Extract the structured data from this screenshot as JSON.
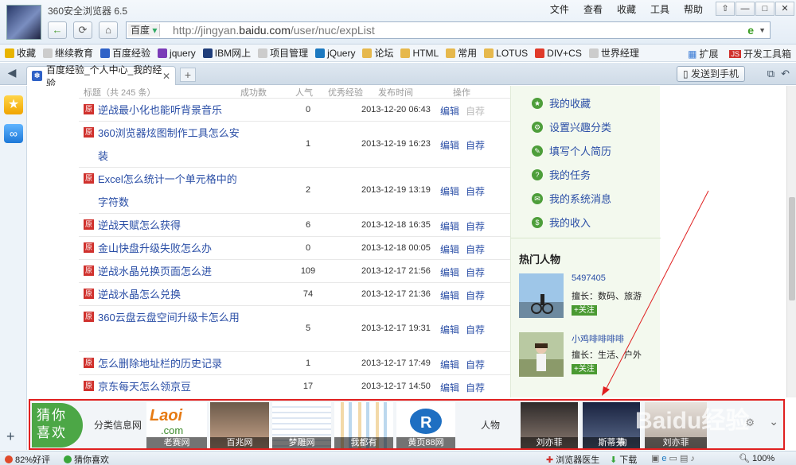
{
  "window": {
    "title": "360安全浏览器 6.5",
    "menus": [
      "文件",
      "查看",
      "收藏",
      "工具",
      "帮助"
    ],
    "controls": [
      "⇧",
      "—",
      "□",
      "✕"
    ]
  },
  "address_bar": {
    "engine": "百度",
    "url_prefix": "http://jingyan.",
    "url_domain": "baidu.com",
    "url_path": "/user/nuc/expList",
    "ie_mode": "e"
  },
  "bookmarks": {
    "items": [
      {
        "label": "收藏",
        "color": "#e8b400"
      },
      {
        "label": "继续教育",
        "color": "#cccccc"
      },
      {
        "label": "百度经验",
        "color": "#2f62c7"
      },
      {
        "label": "jquery",
        "color": "#7b3cb8"
      },
      {
        "label": "IBM网上",
        "color": "#1f3d7a"
      },
      {
        "label": "项目管理",
        "color": "#cccccc"
      },
      {
        "label": "jQuery",
        "color": "#1c79c0"
      },
      {
        "label": "论坛",
        "color": "#e6b84c"
      },
      {
        "label": "HTML",
        "color": "#e6b84c"
      },
      {
        "label": "常用",
        "color": "#e6b84c"
      },
      {
        "label": "LOTUS",
        "color": "#e6b84c"
      },
      {
        "label": "DIV+CS",
        "color": "#e03a2a"
      },
      {
        "label": "世界经理",
        "color": "#cccccc"
      }
    ],
    "right": [
      "扩展",
      "开发工具箱"
    ]
  },
  "tabs": {
    "active_title": "百度经验_个人中心_我的经验",
    "send_to_phone": "发送到手机"
  },
  "table": {
    "headers": [
      "标题（共 245 条）",
      "成功数",
      "人气",
      "优秀经验",
      "发布时间",
      "操作"
    ],
    "badge": "原",
    "rows": [
      {
        "title": "逆战最小化也能听背景音乐",
        "views": "0",
        "date": "2013-12-20 06:43",
        "edit": "编辑",
        "recommend": "自荐",
        "rec_enabled": false
      },
      {
        "title": "360浏览器炫图制作工具怎么安装",
        "views": "1",
        "date": "2013-12-19 16:23",
        "edit": "编辑",
        "recommend": "自荐",
        "rec_enabled": true
      },
      {
        "title": "Excel怎么统计一个单元格中的字符数",
        "views": "2",
        "date": "2013-12-19 13:19",
        "edit": "编辑",
        "recommend": "自荐",
        "rec_enabled": true
      },
      {
        "title": "逆战天赋怎么获得",
        "views": "6",
        "date": "2013-12-18 16:35",
        "edit": "编辑",
        "recommend": "自荐",
        "rec_enabled": true
      },
      {
        "title": "金山快盘升级失败怎么办",
        "views": "0",
        "date": "2013-12-18 00:05",
        "edit": "编辑",
        "recommend": "自荐",
        "rec_enabled": true
      },
      {
        "title": "逆战水晶兑换页面怎么进",
        "views": "109",
        "date": "2013-12-17 21:56",
        "edit": "编辑",
        "recommend": "自荐",
        "rec_enabled": true
      },
      {
        "title": "逆战水晶怎么兑换",
        "views": "74",
        "date": "2013-12-17 21:36",
        "edit": "编辑",
        "recommend": "自荐",
        "rec_enabled": true
      },
      {
        "title": "360云盘云盘空间升级卡怎么用",
        "views": "5",
        "date": "2013-12-17 19:31",
        "edit": "编辑",
        "recommend": "自荐",
        "rec_enabled": true
      },
      {
        "title": "怎么删除地址栏的历史记录",
        "views": "1",
        "date": "2013-12-17 17:49",
        "edit": "编辑",
        "recommend": "自荐",
        "rec_enabled": true
      },
      {
        "title": "京东每天怎么领京豆",
        "views": "17",
        "date": "2013-12-17 14:50",
        "edit": "编辑",
        "recommend": "自荐",
        "rec_enabled": true
      }
    ]
  },
  "right_panel": {
    "links": [
      {
        "label": "我的收藏",
        "icon": "star-icon"
      },
      {
        "label": "设置兴趣分类",
        "icon": "gear-icon"
      },
      {
        "label": "填写个人简历",
        "icon": "edit-icon"
      },
      {
        "label": "我的任务",
        "icon": "task-icon"
      },
      {
        "label": "我的系统消息",
        "icon": "mail-icon"
      },
      {
        "label": "我的收入",
        "icon": "money-icon"
      }
    ],
    "hot_title": "热门人物",
    "people": [
      {
        "name": "5497405",
        "skill": "擅长：数码、旅游",
        "follow": "+关注"
      },
      {
        "name": "小鸡啡啡啡啡",
        "skill": "擅长：生活、户外",
        "follow": "+关注"
      }
    ]
  },
  "guess_bar": {
    "badge_line1": "猜你",
    "badge_line2": "喜欢",
    "category_label": "分类信息网",
    "people_label": "人物",
    "tiles": [
      "老赛网",
      "百兆网",
      "梦雕网",
      "我都有",
      "黄页88网",
      "刘亦菲",
      "斯蒂芬",
      "鞠",
      "刘亦菲"
    ],
    "logo_text": "Laoi",
    "logo_sub": ".com",
    "watermark": "Baidu经验"
  },
  "status_bar": {
    "rating": "82%好评",
    "guess": "猜你喜欢",
    "doctor": "浏览器医生",
    "download": "下载",
    "zoom": "100%"
  }
}
